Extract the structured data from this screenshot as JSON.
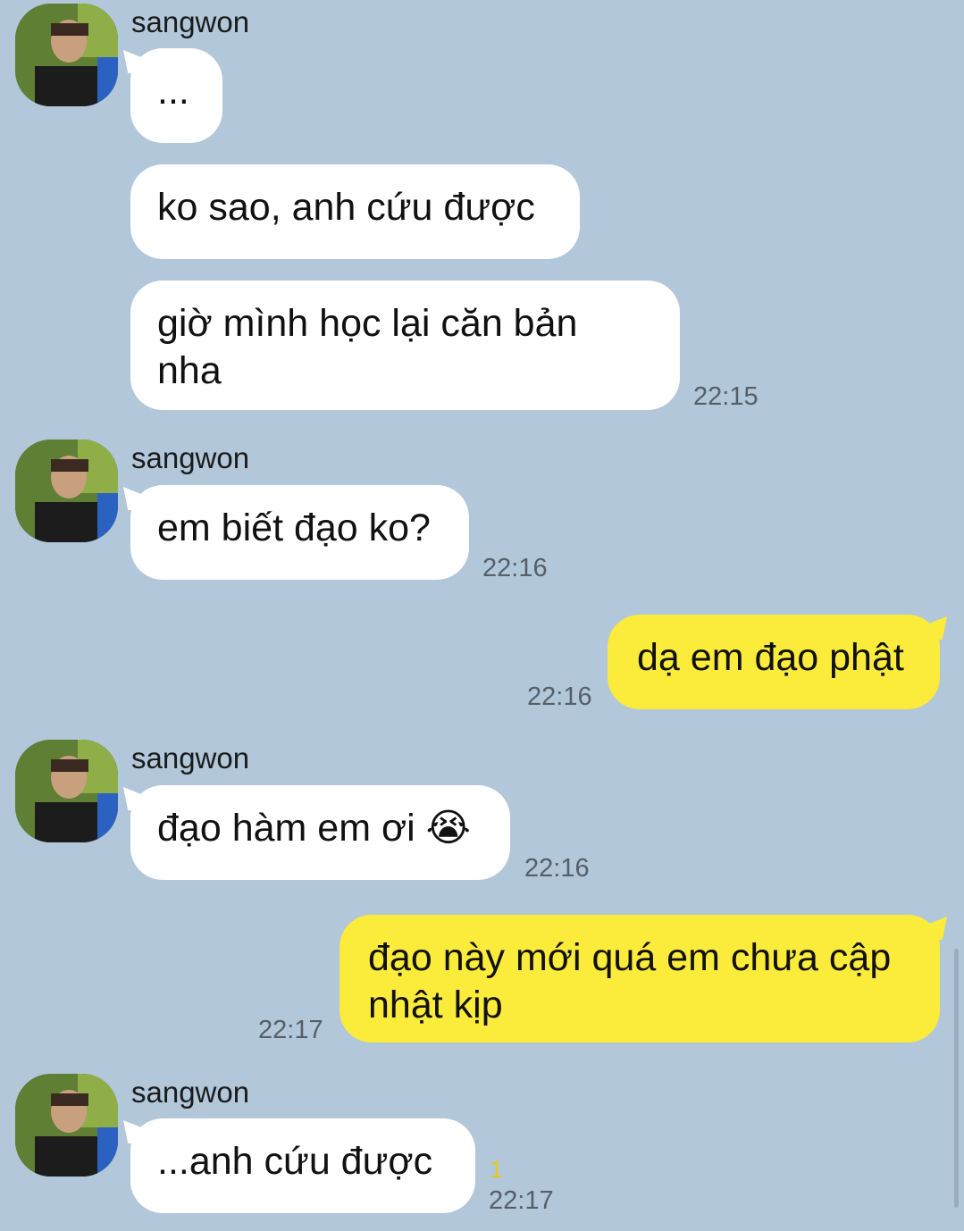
{
  "sender": {
    "name": "sangwon"
  },
  "messages": [
    {
      "text": "...",
      "time": ""
    },
    {
      "text": "ko sao, anh cứu được",
      "time": ""
    },
    {
      "text": "giờ mình học lại căn bản nha",
      "time": "22:15"
    },
    {
      "text": "em biết đạo ko?",
      "time": "22:16"
    },
    {
      "text": "dạ em đạo phật",
      "time": "22:16"
    },
    {
      "text": "đạo hàm em ơi 😭",
      "time": "22:16"
    },
    {
      "text": "đạo này mới quá em chưa cập nhật kịp",
      "time": "22:17"
    },
    {
      "text": "...anh cứu được",
      "time": "22:17",
      "unread": "1"
    }
  ],
  "colors": {
    "background": "#b2c7da",
    "incoming_bubble": "#ffffff",
    "outgoing_bubble": "#fbeb3b",
    "unread": "#e5c81c"
  },
  "icons": {
    "avatar": "user-avatar-photo"
  }
}
